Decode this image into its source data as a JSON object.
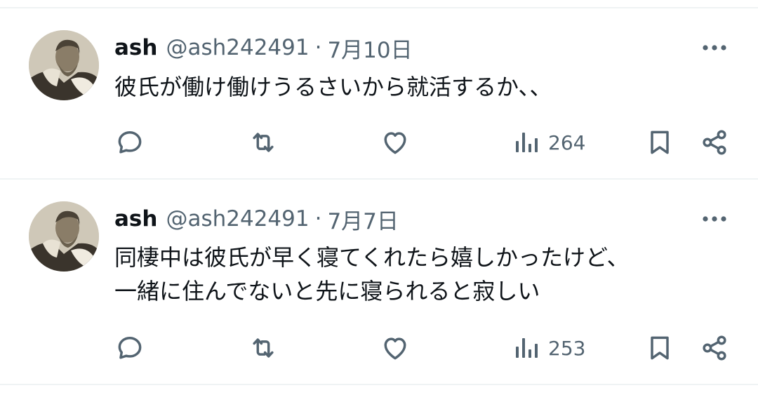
{
  "colors": {
    "text": "#0f1419",
    "secondary": "#536471",
    "divider": "#eff3f4"
  },
  "posts": [
    {
      "author_name": "ash",
      "handle": "@ash242491",
      "separator": "·",
      "date": "7月10日",
      "text_lines": [
        "彼氏が働け働けうるさいから就活するか、、"
      ],
      "views": "264",
      "icons": [
        "more-icon",
        "reply-icon",
        "repost-icon",
        "like-icon",
        "views-icon",
        "bookmark-icon",
        "share-icon"
      ]
    },
    {
      "author_name": "ash",
      "handle": "@ash242491",
      "separator": "·",
      "date": "7月7日",
      "text_lines": [
        "同棲中は彼氏が早く寝てくれたら嬉しかったけど、",
        "一緒に住んでないと先に寝られると寂しい"
      ],
      "views": "253",
      "icons": [
        "more-icon",
        "reply-icon",
        "repost-icon",
        "like-icon",
        "views-icon",
        "bookmark-icon",
        "share-icon"
      ]
    }
  ]
}
